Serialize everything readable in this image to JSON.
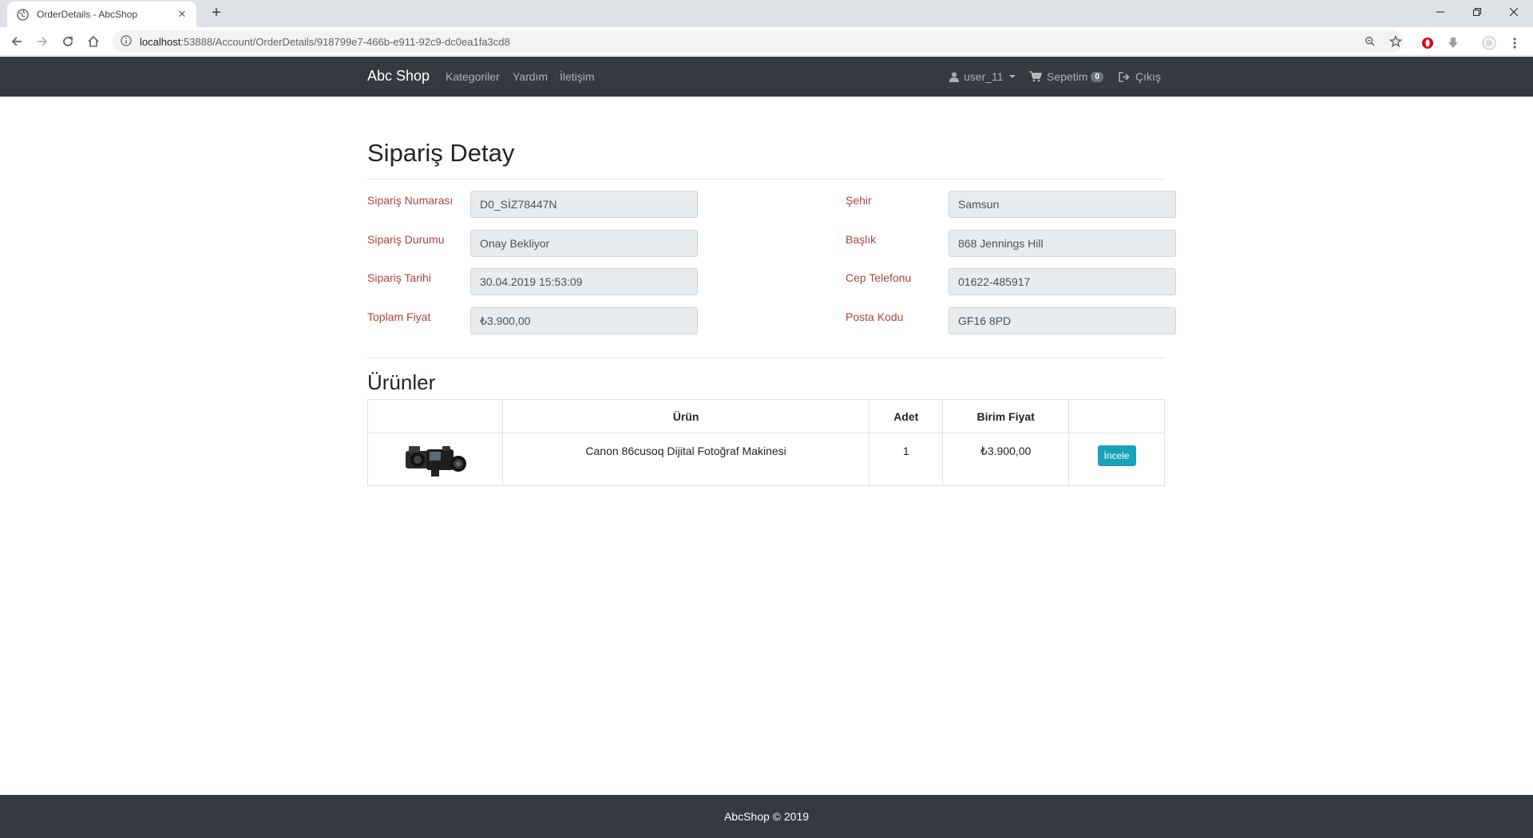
{
  "browser": {
    "tab_title": "OrderDetails - AbcShop",
    "url_host": "localhost",
    "url_rest": ":53888/Account/OrderDetails/918799e7-466b-e911-92c9-dc0ea1fa3cd8"
  },
  "navbar": {
    "brand": "Abc Shop",
    "links": [
      "Kategoriler",
      "Yardım",
      "İletişim"
    ],
    "user": "user_11",
    "cart_label": "Sepetim",
    "cart_count": "0",
    "logout": "Çıkış"
  },
  "page": {
    "title": "Sipariş Detay",
    "left_fields": [
      {
        "label": "Sipariş Numarası",
        "value": "D0_SİZ78447N"
      },
      {
        "label": "Sipariş Durumu",
        "value": "Onay Bekliyor"
      },
      {
        "label": "Sipariş Tarihi",
        "value": "30.04.2019 15:53:09"
      },
      {
        "label": "Toplam Fiyat",
        "value": "₺3.900,00"
      }
    ],
    "right_fields": [
      {
        "label": "Şehir",
        "value": "Samsun"
      },
      {
        "label": "Başlık",
        "value": "868 Jennings Hill"
      },
      {
        "label": "Cep Telefonu",
        "value": "01622-485917"
      },
      {
        "label": "Posta Kodu",
        "value": "GF16 8PD"
      }
    ]
  },
  "products": {
    "title": "Ürünler",
    "headers": [
      "",
      "Ürün",
      "Adet",
      "Birim Fiyat",
      ""
    ],
    "rows": [
      {
        "name": "Canon 86cusoq Dijital Fotoğraf Makinesi",
        "qty": "1",
        "price": "₺3.900,00",
        "action": "İncele"
      }
    ]
  },
  "footer": {
    "text": "AbcShop © 2019"
  },
  "colors": {
    "navbar_bg": "#343a40",
    "label_red": "#a94442",
    "button_info": "#17a2b8"
  }
}
